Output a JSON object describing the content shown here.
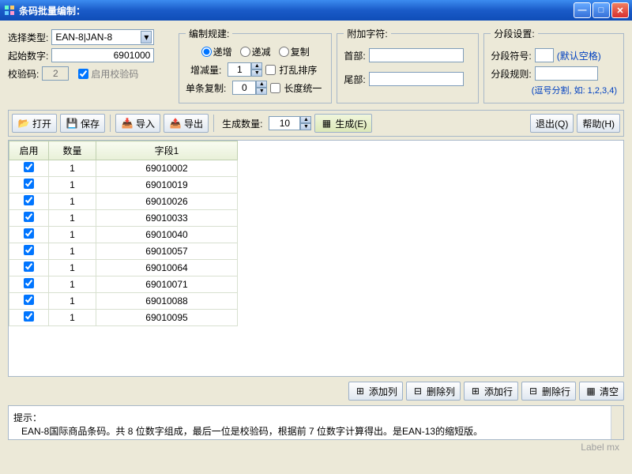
{
  "window": {
    "title": "条码批量编制："
  },
  "left": {
    "type_label": "选择类型:",
    "type_value": "EAN-8|JAN-8",
    "start_label": "起始数字:",
    "start_value": "6901000",
    "check_label": "校验码:",
    "check_value": "2",
    "enable_check": "启用校验码"
  },
  "rules": {
    "legend": "编制规建:",
    "inc": "递增",
    "dec": "递减",
    "copy": "复制",
    "step_label": "增减量:",
    "step_value": "1",
    "shuffle": "打乱排序",
    "repeat_label": "单条复制:",
    "repeat_value": "0",
    "uniform": "长度统一"
  },
  "append": {
    "legend": "附加字符:",
    "head_label": "首部:",
    "head_value": "",
    "tail_label": "尾部:",
    "tail_value": ""
  },
  "seg": {
    "legend": "分段设置:",
    "sym_label": "分段符号:",
    "sym_default": "(默认空格)",
    "rule_label": "分段规则:",
    "hint": "(逗号分割, 如: 1,2,3,4)"
  },
  "toolbar": {
    "open": "打开",
    "save": "保存",
    "import": "导入",
    "export": "导出",
    "gen_count_label": "生成数量:",
    "gen_count": "10",
    "generate": "生成(E)",
    "exit": "退出(Q)",
    "help": "帮助(H)"
  },
  "table": {
    "headers": {
      "enabled": "启用",
      "qty": "数量",
      "field1": "字段1"
    },
    "rows": [
      {
        "enabled": true,
        "qty": "1",
        "field1": "69010002"
      },
      {
        "enabled": true,
        "qty": "1",
        "field1": "69010019"
      },
      {
        "enabled": true,
        "qty": "1",
        "field1": "69010026"
      },
      {
        "enabled": true,
        "qty": "1",
        "field1": "69010033"
      },
      {
        "enabled": true,
        "qty": "1",
        "field1": "69010040"
      },
      {
        "enabled": true,
        "qty": "1",
        "field1": "69010057"
      },
      {
        "enabled": true,
        "qty": "1",
        "field1": "69010064"
      },
      {
        "enabled": true,
        "qty": "1",
        "field1": "69010071"
      },
      {
        "enabled": true,
        "qty": "1",
        "field1": "69010088"
      },
      {
        "enabled": true,
        "qty": "1",
        "field1": "69010095"
      }
    ]
  },
  "bottom": {
    "add_col": "添加列",
    "del_col": "删除列",
    "add_row": "添加行",
    "del_row": "删除行",
    "clear": "清空"
  },
  "hint": {
    "label": "提示：",
    "text": "EAN-8国际商品条码。共 8 位数字组成，最后一位是校验码，根据前 7 位数字计算得出。是EAN-13的缩短版。"
  },
  "footer": "Label mx"
}
